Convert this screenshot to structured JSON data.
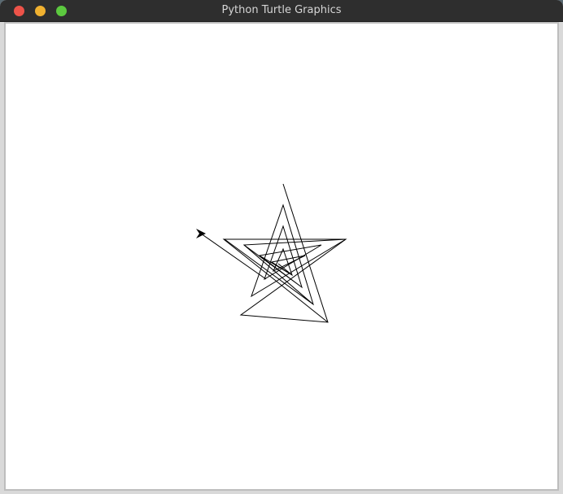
{
  "window": {
    "title": "Python Turtle Graphics",
    "controls": {
      "close_color": "#ed5349",
      "minimize_color": "#f0b130",
      "maximize_color": "#5cc93f"
    }
  },
  "canvas": {
    "background": "#ffffff",
    "pen_color": "#000000",
    "turtle_shape": "classic-arrow"
  }
}
